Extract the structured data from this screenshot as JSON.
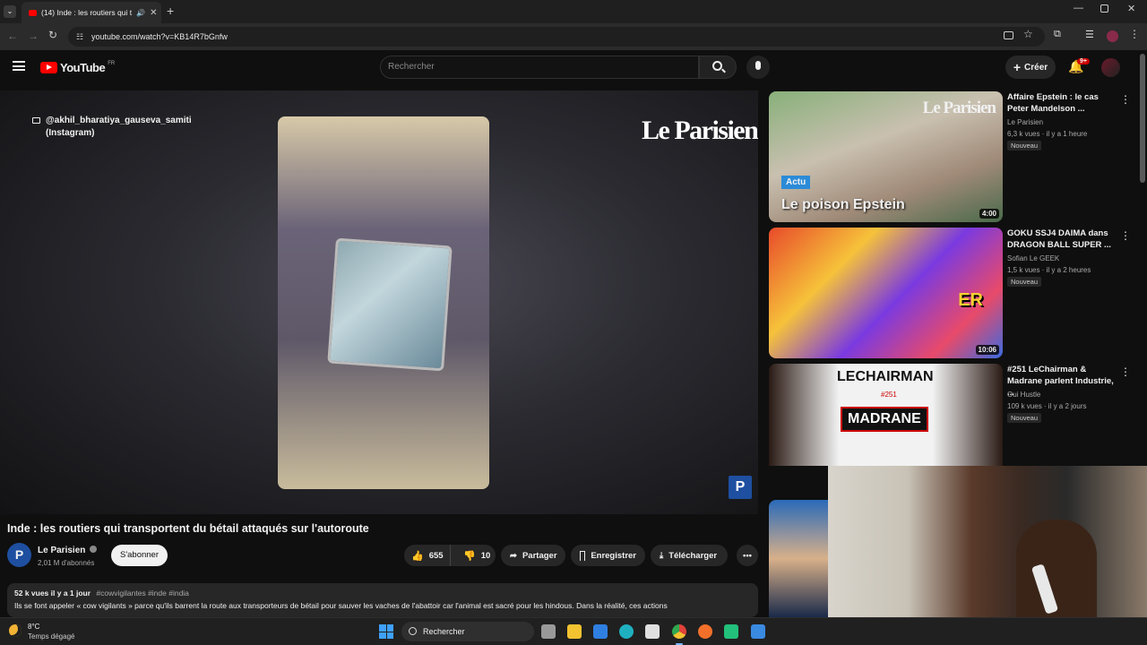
{
  "browser": {
    "tab_title": "(14) Inde : les routiers qui t",
    "url": "youtube.com/watch?v=KB14R7bGnfw"
  },
  "youtube": {
    "logo": "YouTube",
    "region": "FR",
    "search_placeholder": "Rechercher",
    "create_label": "Créer",
    "notifications_count": "9+"
  },
  "video": {
    "overlay_handle": "@akhil_bharatiya_gauseva_samiti",
    "overlay_source": "(Instagram)",
    "brand": "Le Parisien",
    "corner_logo": "P",
    "title": "Inde : les routiers qui transportent du bétail attaqués sur l'autoroute"
  },
  "channel": {
    "name": "Le Parisien",
    "subscribers": "2,01 M d'abonnés",
    "subscribe_label": "S'abonner",
    "avatar_letter": "P"
  },
  "actions": {
    "likes": "655",
    "dislikes": "10",
    "share": "Partager",
    "save": "Enregistrer",
    "download": "Télécharger"
  },
  "description": {
    "views_date": "52 k vues  il y a 1 jour",
    "hashtags": "#cowvigilantes #inde #india",
    "text": "Ils se font appeler « cow vigilants » parce qu'ils barrent la route aux transporteurs de bétail pour sauver les vaches de l'abattoir car l'animal est sacré pour les hindous. Dans la réalité, ces actions"
  },
  "recommendations": [
    {
      "title": "Affaire Epstein : le cas Peter Mandelson ...",
      "channel": "Le Parisien",
      "meta": "6,3 k vues · il y a 1 heure",
      "badge": "Nouveau",
      "duration": "4:00",
      "thumb_label": "Actu",
      "thumb_caption": "Le poison Epstein",
      "thumb_brand": "Le Parisien"
    },
    {
      "title": "GOKU SSJ4 DAIMA dans DRAGON BALL SUPER ...",
      "channel": "Sofian Le GEEK",
      "meta": "1,5 k vues · il y a 2 heures",
      "badge": "Nouveau",
      "duration": "10:06",
      "thumb_caption": "ER"
    },
    {
      "title": "#251 LeChairman & Madrane parlent Industrie, ...",
      "channel": "Oui Hustle",
      "meta": "109 k vues · il y a 2 jours",
      "badge": "Nouveau",
      "thumb_top": "LECHAIRMAN",
      "thumb_bottom": "MADRANE",
      "thumb_num": "#251"
    }
  ],
  "taskbar": {
    "temperature": "8°C",
    "weather": "Temps dégagé",
    "search": "Rechercher"
  }
}
